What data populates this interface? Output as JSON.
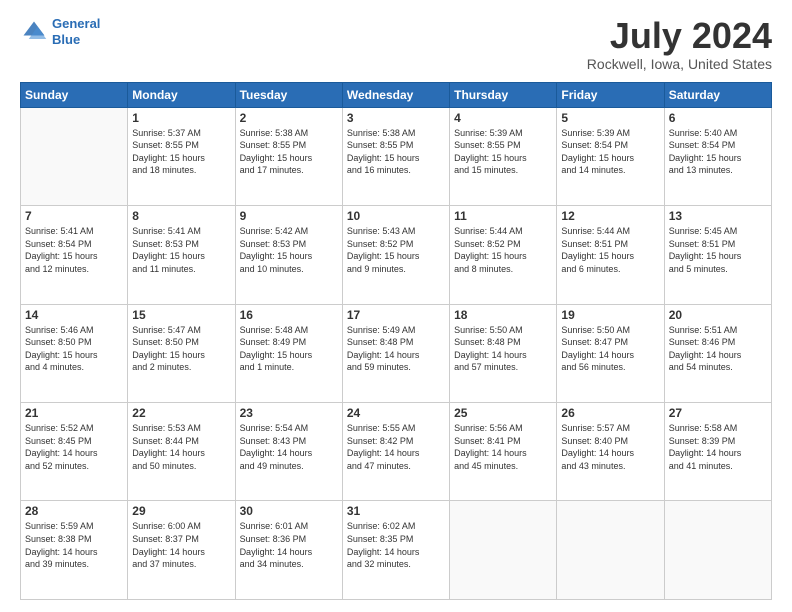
{
  "logo": {
    "line1": "General",
    "line2": "Blue"
  },
  "title": "July 2024",
  "subtitle": "Rockwell, Iowa, United States",
  "days_header": [
    "Sunday",
    "Monday",
    "Tuesday",
    "Wednesday",
    "Thursday",
    "Friday",
    "Saturday"
  ],
  "weeks": [
    [
      {
        "day": "",
        "info": ""
      },
      {
        "day": "1",
        "info": "Sunrise: 5:37 AM\nSunset: 8:55 PM\nDaylight: 15 hours\nand 18 minutes."
      },
      {
        "day": "2",
        "info": "Sunrise: 5:38 AM\nSunset: 8:55 PM\nDaylight: 15 hours\nand 17 minutes."
      },
      {
        "day": "3",
        "info": "Sunrise: 5:38 AM\nSunset: 8:55 PM\nDaylight: 15 hours\nand 16 minutes."
      },
      {
        "day": "4",
        "info": "Sunrise: 5:39 AM\nSunset: 8:55 PM\nDaylight: 15 hours\nand 15 minutes."
      },
      {
        "day": "5",
        "info": "Sunrise: 5:39 AM\nSunset: 8:54 PM\nDaylight: 15 hours\nand 14 minutes."
      },
      {
        "day": "6",
        "info": "Sunrise: 5:40 AM\nSunset: 8:54 PM\nDaylight: 15 hours\nand 13 minutes."
      }
    ],
    [
      {
        "day": "7",
        "info": "Sunrise: 5:41 AM\nSunset: 8:54 PM\nDaylight: 15 hours\nand 12 minutes."
      },
      {
        "day": "8",
        "info": "Sunrise: 5:41 AM\nSunset: 8:53 PM\nDaylight: 15 hours\nand 11 minutes."
      },
      {
        "day": "9",
        "info": "Sunrise: 5:42 AM\nSunset: 8:53 PM\nDaylight: 15 hours\nand 10 minutes."
      },
      {
        "day": "10",
        "info": "Sunrise: 5:43 AM\nSunset: 8:52 PM\nDaylight: 15 hours\nand 9 minutes."
      },
      {
        "day": "11",
        "info": "Sunrise: 5:44 AM\nSunset: 8:52 PM\nDaylight: 15 hours\nand 8 minutes."
      },
      {
        "day": "12",
        "info": "Sunrise: 5:44 AM\nSunset: 8:51 PM\nDaylight: 15 hours\nand 6 minutes."
      },
      {
        "day": "13",
        "info": "Sunrise: 5:45 AM\nSunset: 8:51 PM\nDaylight: 15 hours\nand 5 minutes."
      }
    ],
    [
      {
        "day": "14",
        "info": "Sunrise: 5:46 AM\nSunset: 8:50 PM\nDaylight: 15 hours\nand 4 minutes."
      },
      {
        "day": "15",
        "info": "Sunrise: 5:47 AM\nSunset: 8:50 PM\nDaylight: 15 hours\nand 2 minutes."
      },
      {
        "day": "16",
        "info": "Sunrise: 5:48 AM\nSunset: 8:49 PM\nDaylight: 15 hours\nand 1 minute."
      },
      {
        "day": "17",
        "info": "Sunrise: 5:49 AM\nSunset: 8:48 PM\nDaylight: 14 hours\nand 59 minutes."
      },
      {
        "day": "18",
        "info": "Sunrise: 5:50 AM\nSunset: 8:48 PM\nDaylight: 14 hours\nand 57 minutes."
      },
      {
        "day": "19",
        "info": "Sunrise: 5:50 AM\nSunset: 8:47 PM\nDaylight: 14 hours\nand 56 minutes."
      },
      {
        "day": "20",
        "info": "Sunrise: 5:51 AM\nSunset: 8:46 PM\nDaylight: 14 hours\nand 54 minutes."
      }
    ],
    [
      {
        "day": "21",
        "info": "Sunrise: 5:52 AM\nSunset: 8:45 PM\nDaylight: 14 hours\nand 52 minutes."
      },
      {
        "day": "22",
        "info": "Sunrise: 5:53 AM\nSunset: 8:44 PM\nDaylight: 14 hours\nand 50 minutes."
      },
      {
        "day": "23",
        "info": "Sunrise: 5:54 AM\nSunset: 8:43 PM\nDaylight: 14 hours\nand 49 minutes."
      },
      {
        "day": "24",
        "info": "Sunrise: 5:55 AM\nSunset: 8:42 PM\nDaylight: 14 hours\nand 47 minutes."
      },
      {
        "day": "25",
        "info": "Sunrise: 5:56 AM\nSunset: 8:41 PM\nDaylight: 14 hours\nand 45 minutes."
      },
      {
        "day": "26",
        "info": "Sunrise: 5:57 AM\nSunset: 8:40 PM\nDaylight: 14 hours\nand 43 minutes."
      },
      {
        "day": "27",
        "info": "Sunrise: 5:58 AM\nSunset: 8:39 PM\nDaylight: 14 hours\nand 41 minutes."
      }
    ],
    [
      {
        "day": "28",
        "info": "Sunrise: 5:59 AM\nSunset: 8:38 PM\nDaylight: 14 hours\nand 39 minutes."
      },
      {
        "day": "29",
        "info": "Sunrise: 6:00 AM\nSunset: 8:37 PM\nDaylight: 14 hours\nand 37 minutes."
      },
      {
        "day": "30",
        "info": "Sunrise: 6:01 AM\nSunset: 8:36 PM\nDaylight: 14 hours\nand 34 minutes."
      },
      {
        "day": "31",
        "info": "Sunrise: 6:02 AM\nSunset: 8:35 PM\nDaylight: 14 hours\nand 32 minutes."
      },
      {
        "day": "",
        "info": ""
      },
      {
        "day": "",
        "info": ""
      },
      {
        "day": "",
        "info": ""
      }
    ]
  ]
}
